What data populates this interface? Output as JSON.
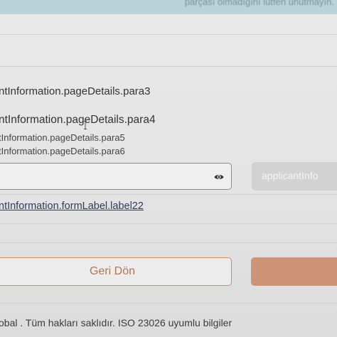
{
  "notice": {
    "text": "parçası olmadığını lütfen unutmayın."
  },
  "page_details": {
    "para3": "ntInformation.pageDetails.para3",
    "para4": "ntInformation.pageDetails.para4",
    "para5": "tInformation.pageDetails.para5",
    "para6": "tInformation.pageDetails.para6"
  },
  "password_field": {
    "value": "",
    "icon": "eye-icon"
  },
  "submit_button": {
    "label": "applicantInfo",
    "state": "disabled"
  },
  "form_label": {
    "label22": "ntInformation.formLabel.label22"
  },
  "actions": {
    "back_label": "Geri Dön",
    "next_label": ""
  },
  "footer": {
    "text": "obal . Tüm hakları saklıdır. ISO 23026 uyumlu bilgiler"
  },
  "colors": {
    "notice_bg": "#b9d3d9",
    "accent": "#cf9375",
    "back_border": "#c98a6e",
    "link": "#2f3b5c"
  }
}
